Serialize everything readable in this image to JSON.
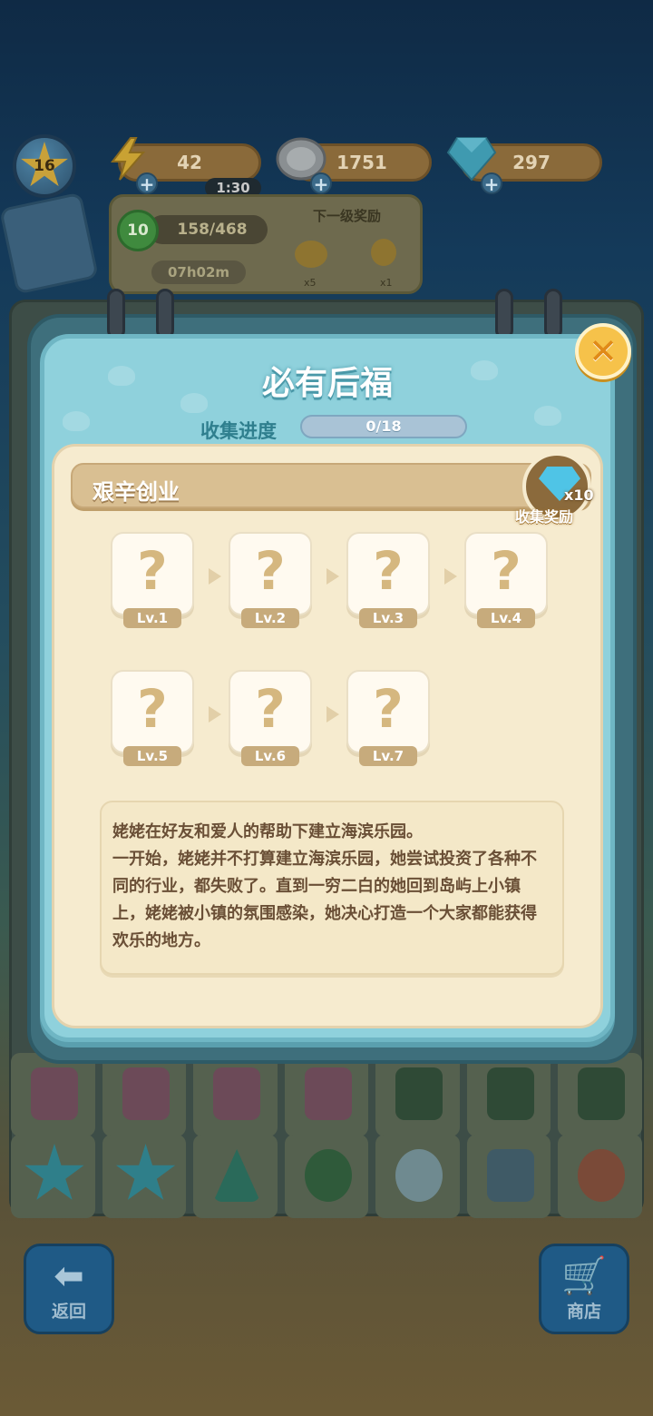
{
  "hud": {
    "level": "16",
    "energy": "42",
    "energy_timer": "1:30",
    "coins": "1751",
    "gems": "297",
    "xp_level": "10",
    "xp_progress": "158/468",
    "xp_timer": "07h02m",
    "next_reward_title": "下一级奖励",
    "next_reward_counts": [
      "x5",
      "x1"
    ]
  },
  "bottom": {
    "back_label": "返回",
    "shop_label": "商店"
  },
  "modal": {
    "title": "必有后福",
    "progress_label": "收集进度",
    "progress_text": "0/18",
    "progress_fraction": 0,
    "chapter_title": "艰辛创业",
    "reward_count": "x10",
    "reward_label": "收集奖励",
    "cards": [
      {
        "symbol": "?",
        "level": "Lv.1"
      },
      {
        "symbol": "?",
        "level": "Lv.2"
      },
      {
        "symbol": "?",
        "level": "Lv.3"
      },
      {
        "symbol": "?",
        "level": "Lv.4"
      },
      {
        "symbol": "?",
        "level": "Lv.5"
      },
      {
        "symbol": "?",
        "level": "Lv.6"
      },
      {
        "symbol": "?",
        "level": "Lv.7"
      }
    ],
    "story": "姥姥在好友和爱人的帮助下建立海滨乐园。\n一开始，姥姥并不打算建立海滨乐园，她尝试投资了各种不同的行业，都失败了。直到一穷二白的她回到岛屿上小镇上，姥姥被小镇的氛围感染，她决心打造一个大家都能获得欢乐的地方。"
  },
  "colors": {
    "modal_bg": "#8fd1dc",
    "content_bg": "#f6ebcf",
    "close_button": "#f6c24a",
    "question_mark": "#d5b77f"
  },
  "icons": [
    "star-icon",
    "lightning-icon",
    "coin-icon",
    "gem-icon",
    "plus-icon",
    "calendar-icon",
    "close-icon",
    "question-icon",
    "arrow-right-icon",
    "back-arrow-icon",
    "cart-icon"
  ]
}
